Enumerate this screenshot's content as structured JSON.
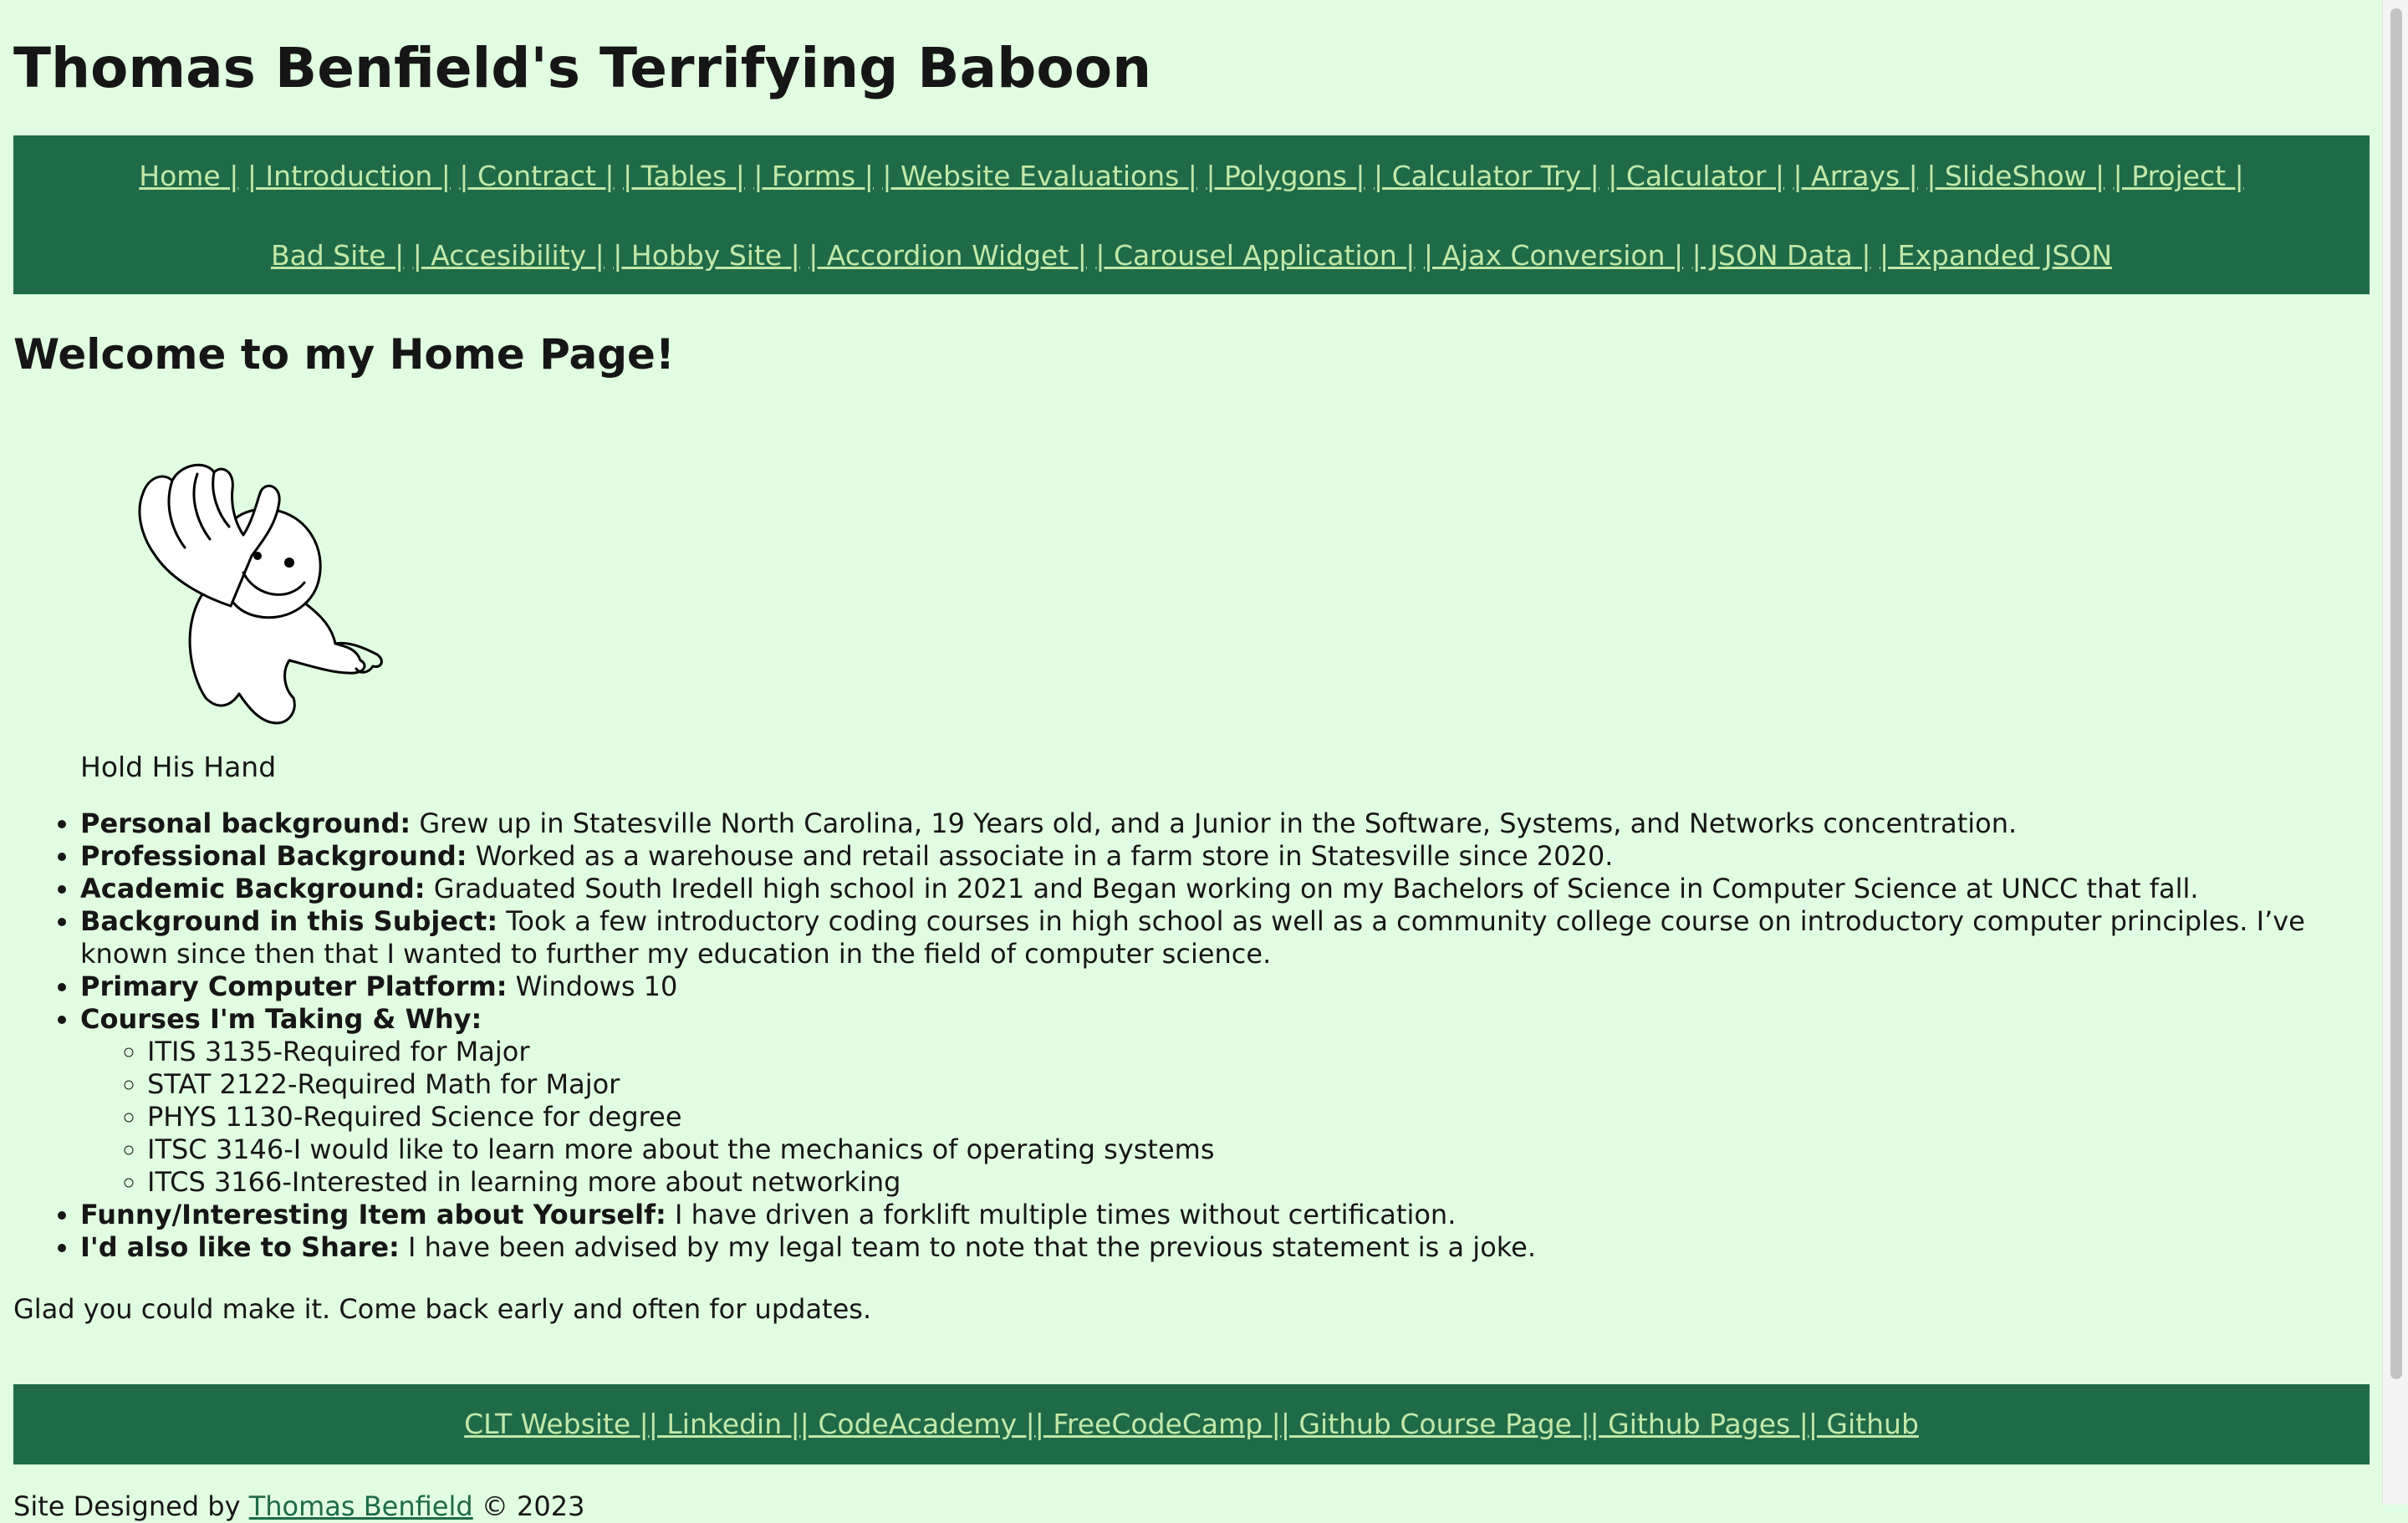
{
  "header": {
    "title": "Thomas Benfield's Terrifying Baboon"
  },
  "nav": {
    "row1": [
      {
        "label": "Home |",
        "sep": " "
      },
      {
        "label": "| Introduction |",
        "sep": " "
      },
      {
        "label": "| Contract |",
        "sep": " "
      },
      {
        "label": "| Tables |",
        "sep": " "
      },
      {
        "label": "| Forms |",
        "sep": " "
      },
      {
        "label": "| Website Evaluations |",
        "sep": " "
      },
      {
        "label": "| Polygons |",
        "sep": " "
      },
      {
        "label": "| Calculator Try |",
        "sep": " "
      },
      {
        "label": "| Calculator |",
        "sep": " "
      },
      {
        "label": "| Arrays |",
        "sep": " "
      },
      {
        "label": "| SlideShow |",
        "sep": " "
      },
      {
        "label": "| Project |",
        "sep": ""
      }
    ],
    "row2": [
      {
        "label": "Bad Site |",
        "sep": " "
      },
      {
        "label": "| Accesibility |",
        "sep": " "
      },
      {
        "label": "| Hobby Site |",
        "sep": " "
      },
      {
        "label": "| Accordion Widget |",
        "sep": " "
      },
      {
        "label": "| Carousel Application |",
        "sep": " "
      },
      {
        "label": "| Ajax Conversion |",
        "sep": " "
      },
      {
        "label": "| JSON Data |",
        "sep": " "
      },
      {
        "label": "| Expanded JSON",
        "sep": ""
      }
    ]
  },
  "main": {
    "heading": "Welcome to my Home Page!",
    "figure_caption": "Hold His Hand",
    "bio": [
      {
        "key": "personal",
        "label": "Personal background:",
        "text": " Grew up in Statesville North Carolina, 19 Years old, and a Junior in the Software, Systems, and Networks concentration."
      },
      {
        "key": "professional",
        "label": "Professional Background:",
        "text": " Worked as a warehouse and retail associate in a farm store in Statesville since 2020."
      },
      {
        "key": "academic",
        "label": "Academic Background:",
        "text": " Graduated South Iredell high school in 2021 and Began working on my Bachelors of Science in Computer Science at UNCC that fall."
      },
      {
        "key": "subject",
        "label": "Background in this Subject:",
        "text": " Took a few introductory coding courses in high school as well as a community college course on introductory computer principles. I’ve known since then that I wanted to further my education in the field of computer science."
      },
      {
        "key": "platform",
        "label": "Primary Computer Platform:",
        "text": " Windows 10"
      }
    ],
    "courses_label": "Courses I'm Taking & Why:",
    "courses": [
      "ITIS 3135-Required for Major",
      "STAT 2122-Required Math for Major",
      "PHYS 1130-Required Science for degree",
      "ITSC 3146-I would like to learn more about the mechanics of operating systems",
      "ITCS 3166-Interested in learning more about networking"
    ],
    "bio_tail": [
      {
        "key": "funny",
        "label": "Funny/Interesting Item about Yourself:",
        "text": " I have driven a forklift multiple times without certification."
      },
      {
        "key": "share",
        "label": "I'd also like to Share:",
        "text": " I have been advised by my legal team to note that the previous statement is a joke."
      }
    ],
    "closing": "Glad you could make it. Come back early and often for updates."
  },
  "footer": {
    "links": [
      {
        "label": "CLT Website |",
        "sep": ""
      },
      {
        "label": "| Linkedin |",
        "sep": ""
      },
      {
        "label": "| CodeAcademy |",
        "sep": ""
      },
      {
        "label": "| FreeCodeCamp |",
        "sep": ""
      },
      {
        "label": "| Github Course Page |",
        "sep": ""
      },
      {
        "label": "| Github Pages |",
        "sep": ""
      },
      {
        "label": "| Github",
        "sep": ""
      }
    ],
    "credit_prefix": "Site Designed by",
    "credit_link": "Thomas Benfield",
    "credit_suffix": "© 2023"
  },
  "colors": {
    "background": "#e1fde1",
    "nav_bg": "#1f6b48",
    "link": "#c2e8a8"
  },
  "icons": {
    "figure": "waving-cartoon-figure-image"
  }
}
